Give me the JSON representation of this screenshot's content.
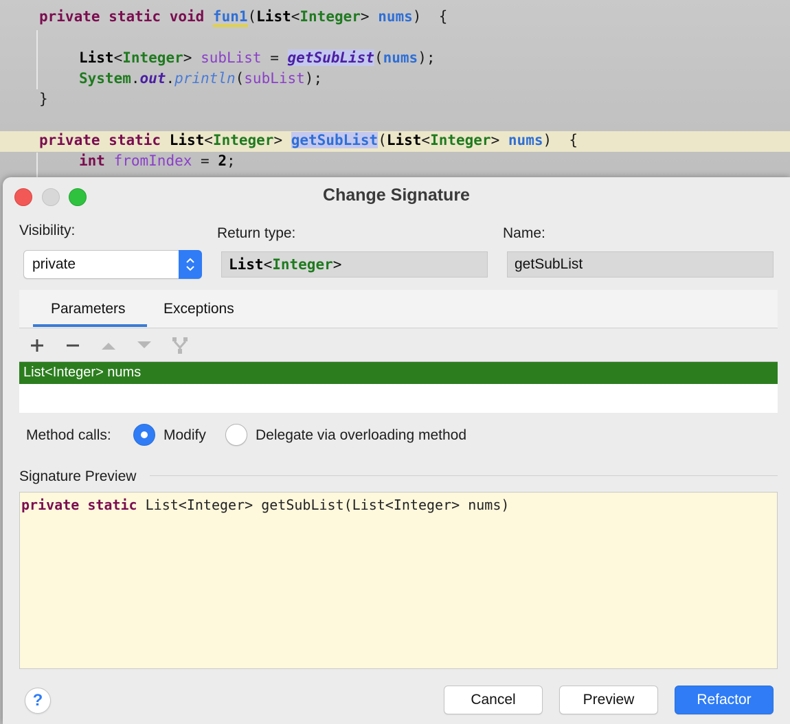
{
  "editor": {
    "line1": {
      "kw1": "private",
      "kw2": "static",
      "kw3": "void",
      "method": "fun1",
      "open": "(",
      "type": "List",
      "lt": "<",
      "gen": "Integer",
      "gt": ">",
      "param": "nums",
      "close": ")  {"
    },
    "line2": {
      "type": "List",
      "lt": "<",
      "gen": "Integer",
      "gt": ">",
      "var": "subList",
      "eq": " = ",
      "call": "getSubList",
      "open": "(",
      "arg": "nums",
      "close": ");"
    },
    "line3": {
      "cls": "System",
      "dot1": ".",
      "field": "out",
      "dot2": ".",
      "meth": "println",
      "open": "(",
      "arg": "subList",
      "close": ");"
    },
    "line4": "}",
    "line5": {
      "kw1": "private",
      "kw2": "static",
      "type": "List",
      "lt": "<",
      "gen": "Integer",
      "gt": ">",
      "method": "getSubList",
      "open": "(",
      "ptype": "List",
      "plt": "<",
      "pgen": "Integer",
      "pgt": ">",
      "param": "nums",
      "close": ")  {"
    },
    "line6": {
      "kw": "int",
      "var": "fromIndex",
      "eq": " = ",
      "num": "2",
      "semi": ";"
    }
  },
  "dialog": {
    "title": "Change Signature",
    "visibility_label": "Visibility:",
    "visibility_value": "private",
    "return_type_label": "Return type:",
    "return_type": {
      "type": "List",
      "lt": "<",
      "gen": "Integer",
      "gt": ">"
    },
    "name_label": "Name:",
    "name_value": "getSubList",
    "tabs": [
      {
        "label": "Parameters"
      },
      {
        "label": "Exceptions"
      }
    ],
    "toolbar_icons": [
      "add-icon",
      "remove-icon",
      "move-up-icon",
      "move-down-icon",
      "propagate-icon"
    ],
    "parameters": [
      "List<Integer> nums"
    ],
    "method_calls_label": "Method calls:",
    "radio_modify": "Modify",
    "radio_delegate": "Delegate via overloading method",
    "signature_preview_label": "Signature Preview",
    "signature_preview": {
      "kw": "private static",
      "rest": " List<Integer> getSubList(List<Integer> nums)"
    },
    "help_label": "?",
    "buttons": {
      "cancel": "Cancel",
      "preview": "Preview",
      "refactor": "Refactor"
    }
  },
  "colors": {
    "accent": "#2f7cf6",
    "selected_row": "#2c7d1e",
    "preview_bg": "#fef8dc",
    "close": "#f25956",
    "zoom": "#2fc23f"
  }
}
